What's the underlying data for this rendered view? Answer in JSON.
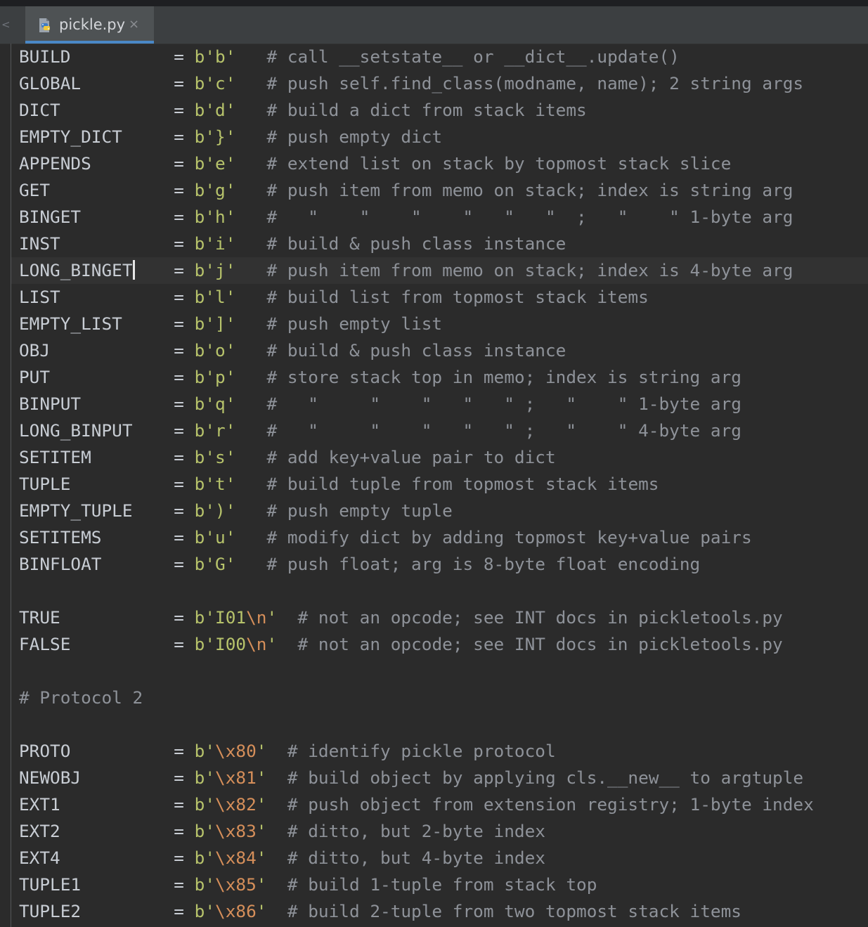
{
  "tab": {
    "filename": "pickle.py",
    "close_glyph": "×",
    "back_glyph": "<"
  },
  "colors": {
    "background": "#2b2b2b",
    "identifier": "#c8cdd4",
    "string": "#b7c36b",
    "escape": "#d68f5a",
    "comment": "#8e9299",
    "tab_underline": "#4a88c7"
  },
  "code": {
    "lines": [
      {
        "name": "BUILD",
        "eq": "= ",
        "val": "b'b'",
        "pad": "   ",
        "comment": "# call __setstate__ or __dict__.update()"
      },
      {
        "name": "GLOBAL",
        "eq": "= ",
        "val": "b'c'",
        "pad": "   ",
        "comment": "# push self.find_class(modname, name); 2 string args"
      },
      {
        "name": "DICT",
        "eq": "= ",
        "val": "b'd'",
        "pad": "   ",
        "comment": "# build a dict from stack items"
      },
      {
        "name": "EMPTY_DICT",
        "eq": "= ",
        "val": "b'}'",
        "pad": "   ",
        "comment": "# push empty dict"
      },
      {
        "name": "APPENDS",
        "eq": "= ",
        "val": "b'e'",
        "pad": "   ",
        "comment": "# extend list on stack by topmost stack slice"
      },
      {
        "name": "GET",
        "eq": "= ",
        "val": "b'g'",
        "pad": "   ",
        "comment": "# push item from memo on stack; index is string arg"
      },
      {
        "name": "BINGET",
        "eq": "= ",
        "val": "b'h'",
        "pad": "   ",
        "comment": "#   \"    \"    \"    \"   \"   \"  ;   \"    \" 1-byte arg"
      },
      {
        "name": "INST",
        "eq": "= ",
        "val": "b'i'",
        "pad": "   ",
        "comment": "# build & push class instance"
      },
      {
        "name": "LONG_BINGET",
        "eq": "= ",
        "val": "b'j'",
        "pad": "   ",
        "comment": "# push item from memo on stack; index is 4-byte arg",
        "current": true
      },
      {
        "name": "LIST",
        "eq": "= ",
        "val": "b'l'",
        "pad": "   ",
        "comment": "# build list from topmost stack items"
      },
      {
        "name": "EMPTY_LIST",
        "eq": "= ",
        "val": "b']'",
        "pad": "   ",
        "comment": "# push empty list"
      },
      {
        "name": "OBJ",
        "eq": "= ",
        "val": "b'o'",
        "pad": "   ",
        "comment": "# build & push class instance"
      },
      {
        "name": "PUT",
        "eq": "= ",
        "val": "b'p'",
        "pad": "   ",
        "comment": "# store stack top in memo; index is string arg"
      },
      {
        "name": "BINPUT",
        "eq": "= ",
        "val": "b'q'",
        "pad": "   ",
        "comment": "#   \"     \"    \"   \"   \" ;   \"    \" 1-byte arg"
      },
      {
        "name": "LONG_BINPUT",
        "eq": "= ",
        "val": "b'r'",
        "pad": "   ",
        "comment": "#   \"     \"    \"   \"   \" ;   \"    \" 4-byte arg"
      },
      {
        "name": "SETITEM",
        "eq": "= ",
        "val": "b's'",
        "pad": "   ",
        "comment": "# add key+value pair to dict"
      },
      {
        "name": "TUPLE",
        "eq": "= ",
        "val": "b't'",
        "pad": "   ",
        "comment": "# build tuple from topmost stack items"
      },
      {
        "name": "EMPTY_TUPLE",
        "eq": "= ",
        "val": "b')'",
        "pad": "   ",
        "comment": "# push empty tuple"
      },
      {
        "name": "SETITEMS",
        "eq": "= ",
        "val": "b'u'",
        "pad": "   ",
        "comment": "# modify dict by adding topmost key+value pairs"
      },
      {
        "name": "BINFLOAT",
        "eq": "= ",
        "val": "b'G'",
        "pad": "   ",
        "comment": "# push float; arg is 8-byte float encoding"
      },
      {
        "blank": true
      },
      {
        "name": "TRUE",
        "eq": "= ",
        "val": "b'I01",
        "esc": "\\n",
        "val_end": "'",
        "pad": "  ",
        "comment": "# not an opcode; see INT docs in pickletools.py"
      },
      {
        "name": "FALSE",
        "eq": "= ",
        "val": "b'I00",
        "esc": "\\n",
        "val_end": "'",
        "pad": "  ",
        "comment": "# not an opcode; see INT docs in pickletools.py"
      },
      {
        "blank": true
      },
      {
        "comment_only": "# Protocol 2"
      },
      {
        "blank": true
      },
      {
        "name": "PROTO",
        "eq": "= ",
        "val": "b'",
        "esc": "\\x80",
        "val_end": "'",
        "pad": "  ",
        "comment": "# identify pickle protocol"
      },
      {
        "name": "NEWOBJ",
        "eq": "= ",
        "val": "b'",
        "esc": "\\x81",
        "val_end": "'",
        "pad": "  ",
        "comment": "# build object by applying cls.__new__ to argtuple"
      },
      {
        "name": "EXT1",
        "eq": "= ",
        "val": "b'",
        "esc": "\\x82",
        "val_end": "'",
        "pad": "  ",
        "comment": "# push object from extension registry; 1-byte index"
      },
      {
        "name": "EXT2",
        "eq": "= ",
        "val": "b'",
        "esc": "\\x83",
        "val_end": "'",
        "pad": "  ",
        "comment": "# ditto, but 2-byte index"
      },
      {
        "name": "EXT4",
        "eq": "= ",
        "val": "b'",
        "esc": "\\x84",
        "val_end": "'",
        "pad": "  ",
        "comment": "# ditto, but 4-byte index"
      },
      {
        "name": "TUPLE1",
        "eq": "= ",
        "val": "b'",
        "esc": "\\x85",
        "val_end": "'",
        "pad": "  ",
        "comment": "# build 1-tuple from stack top"
      },
      {
        "name": "TUPLE2",
        "eq": "= ",
        "val": "b'",
        "esc": "\\x86",
        "val_end": "'",
        "pad": "  ",
        "comment": "# build 2-tuple from two topmost stack items"
      }
    ]
  }
}
